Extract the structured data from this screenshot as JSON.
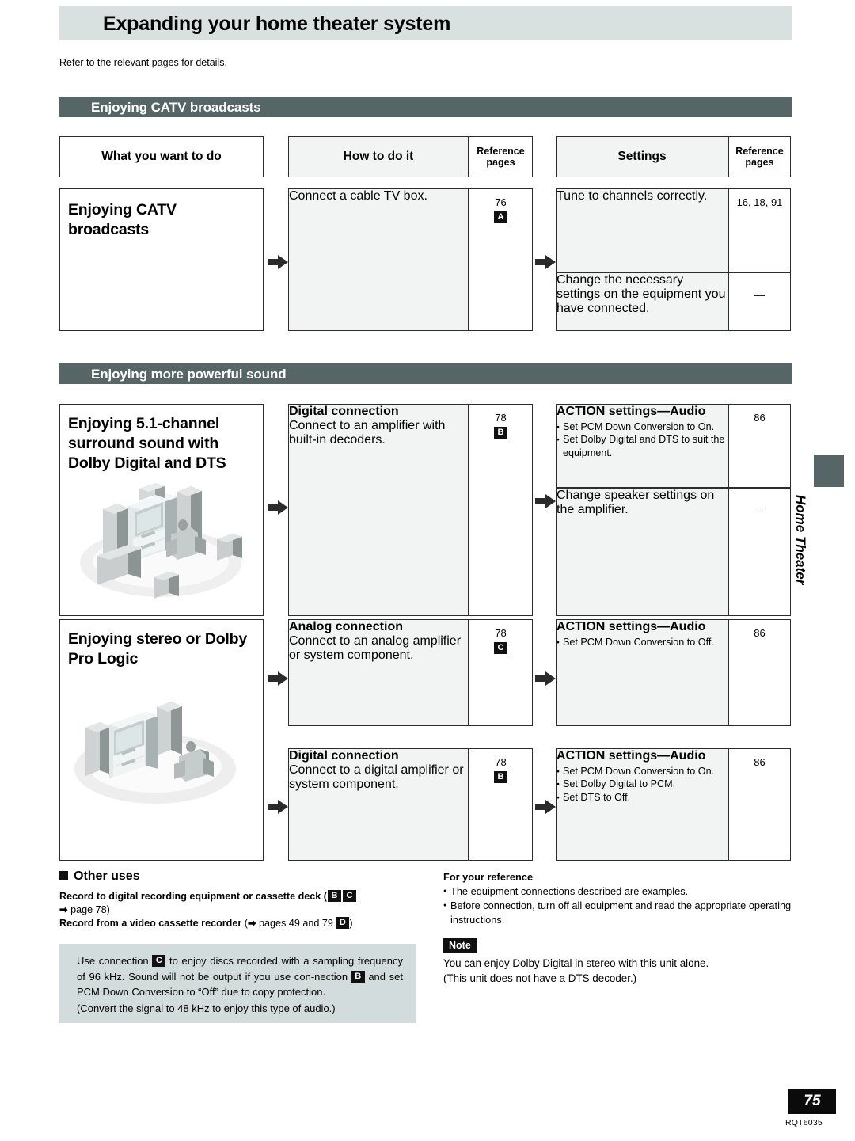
{
  "page": {
    "title": "Expanding your home theater system",
    "intro": "Refer to the relevant pages for details.",
    "side_tab_label": "Home Theater",
    "page_number": "75",
    "doc_code": "RQT6035"
  },
  "columns": {
    "what": "What you want to do",
    "how": "How to do it",
    "settings": "Settings",
    "reference_line1": "Reference",
    "reference_line2": "pages"
  },
  "sections": [
    {
      "heading": "Enjoying CATV broadcasts",
      "rows": [
        {
          "title": "Enjoying CATV broadcasts",
          "illustration": "none",
          "how": [
            {
              "heading": "",
              "text": "Connect a cable TV box.",
              "ref": "76",
              "badge": "A"
            }
          ],
          "settings": [
            {
              "heading": "",
              "text": "Tune to channels correctly.",
              "bullets": [],
              "ref": "16, 18, 91"
            },
            {
              "heading": "",
              "text": "Change the necessary settings on the equipment you have connected.",
              "bullets": [],
              "ref": "—"
            }
          ]
        }
      ]
    },
    {
      "heading": "Enjoying more powerful sound",
      "rows": [
        {
          "title": "Enjoying 5.1-channel surround sound with Dolby Digital and DTS",
          "illustration": "home-theater-5-1",
          "how": [
            {
              "heading": "Digital connection",
              "text": "Connect to an amplifier with built-in decoders.",
              "ref": "78",
              "badge": "B"
            }
          ],
          "settings": [
            {
              "heading": "ACTION settings—Audio",
              "text": "",
              "bullets": [
                "Set PCM Down Conversion to On.",
                "Set Dolby Digital and DTS to suit the equipment."
              ],
              "ref": "86"
            },
            {
              "heading": "",
              "text": "Change speaker settings on the amplifier.",
              "bullets": [],
              "ref": "—"
            }
          ]
        },
        {
          "title": "Enjoying stereo or Dolby Pro Logic",
          "illustration": "home-theater-stereo",
          "how": [
            {
              "heading": "Analog connection",
              "text": "Connect to an analog amplifier or system component.",
              "ref": "78",
              "badge": "C"
            },
            {
              "heading": "Digital connection",
              "text": "Connect to a digital amplifier or system component.",
              "ref": "78",
              "badge": "B"
            }
          ],
          "settings": [
            {
              "heading": "ACTION settings—Audio",
              "text": "",
              "bullets": [
                "Set PCM Down Conversion to Off."
              ],
              "ref": "86"
            },
            {
              "heading": "ACTION settings—Audio",
              "text": "",
              "bullets": [
                "Set PCM Down Conversion to On.",
                "Set Dolby Digital to PCM.",
                "Set DTS to Off."
              ],
              "ref": "86"
            }
          ]
        }
      ]
    }
  ],
  "other_uses": {
    "heading": "Other uses",
    "item1_bold": "Record to digital recording equipment or cassette deck",
    "item1_badges": [
      "B",
      "C"
    ],
    "item1_tail": "page 78)",
    "item2_bold": "Record from a video cassette recorder",
    "item2_tail": "pages 49 and 79",
    "item2_badge": "D"
  },
  "tip_box": {
    "line1_a": "Use connection",
    "line1_badge": "C",
    "line1_b": "to enjoy discs recorded with a sampling frequency of 96 kHz. Sound will not be output if you use con-nection",
    "line2_badge": "B",
    "line2_b": "and set PCM Down Conversion to “Off” due to copy protection.",
    "line3": "(Convert the signal to 48 kHz to enjoy this type of audio.)"
  },
  "reference_panel": {
    "heading": "For your reference",
    "bullets": [
      "The equipment connections described are examples.",
      "Before connection, turn off all equipment and read the appropriate operating instructions."
    ],
    "note_label": "Note",
    "note_lines": [
      "You can enjoy Dolby Digital in stereo with this unit alone.",
      "(This unit does not have a DTS decoder.)"
    ]
  },
  "colors": {
    "title_bar": "#d9e0e0",
    "section_header": "#566566",
    "cell_fill": "#f2f3f3",
    "tip_box": "#d3dcdc",
    "badge": "#111111"
  }
}
